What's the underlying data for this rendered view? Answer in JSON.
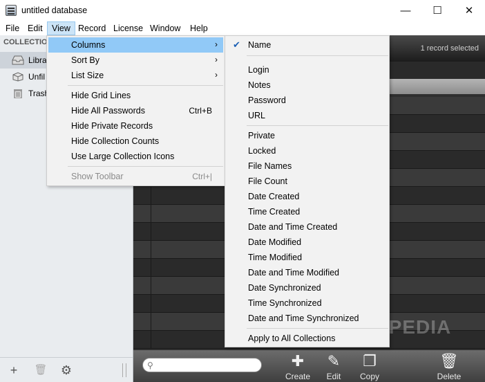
{
  "window": {
    "title": "untitled database",
    "minimize": "—",
    "maximize": "☐",
    "close": "✕"
  },
  "menubar": [
    "File",
    "Edit",
    "View",
    "Record",
    "License",
    "Window",
    "Help"
  ],
  "sidebar": {
    "header": "COLLECTION",
    "items": [
      {
        "label": "Libra",
        "icon": "inbox-icon"
      },
      {
        "label": "Unfil",
        "icon": "box-icon"
      },
      {
        "label": "Trash",
        "icon": "trash-icon"
      }
    ]
  },
  "main": {
    "record_status": "1 record selected"
  },
  "view_menu": {
    "items": [
      {
        "label": "Columns",
        "submenu": true
      },
      {
        "label": "Sort By",
        "submenu": true
      },
      {
        "label": "List Size",
        "submenu": true
      },
      {
        "label": "Hide Grid Lines"
      },
      {
        "label": "Hide All Passwords",
        "shortcut": "Ctrl+B"
      },
      {
        "label": "Hide Private Records"
      },
      {
        "label": "Hide Collection Counts"
      },
      {
        "label": "Use Large Collection Icons"
      },
      {
        "label": "Show Toolbar",
        "shortcut": "Ctrl+|",
        "disabled": true
      }
    ],
    "submenu_arrow": "›"
  },
  "columns_menu": {
    "checkmark": "✔",
    "items": [
      "Name",
      "Login",
      "Notes",
      "Password",
      "URL",
      "Private",
      "Locked",
      "File Names",
      "File Count",
      "Date Created",
      "Time Created",
      "Date and Time Created",
      "Date Modified",
      "Time Modified",
      "Date and Time Modified",
      "Date Synchronized",
      "Time Synchronized",
      "Date and Time Synchronized",
      "Apply to All Collections"
    ]
  },
  "toolbar": {
    "create": "Create",
    "edit": "Edit",
    "copy": "Copy",
    "delete": "Delete",
    "search_placeholder": ""
  },
  "sidebar_tools": {
    "add": "+",
    "remove": "🗑",
    "settings": "⚙"
  },
  "watermark": "SOFTPEDIA",
  "colors": {
    "menu_highlight": "#91c9f7",
    "menubar_active": "#cce4f7",
    "dark_bg": "#2f2f2f"
  }
}
